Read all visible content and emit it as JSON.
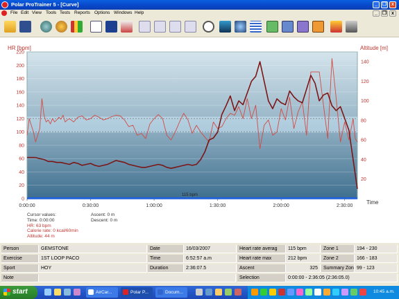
{
  "window": {
    "title": "Polar ProTrainer 5 - [Curve]"
  },
  "window_buttons": {
    "minimize": "_",
    "restore": "❐",
    "close": "x"
  },
  "menu": {
    "items": [
      "File",
      "Edit",
      "View",
      "Tools",
      "Tests",
      "Reports",
      "Options",
      "Windows",
      "Help"
    ]
  },
  "toolbar": {
    "icons": [
      "open-folder-icon",
      "save-disk-icon",
      "add-exercise-icon",
      "settings-wheel-icon",
      "bar-stats-icon",
      "calendar-icon",
      "diary-book-icon",
      "fitness-person-icon",
      "curve-view-icon",
      "bar-view-icon",
      "table-view-icon",
      "laps-view-icon",
      "zoom-icon",
      "upload-icon",
      "sync-icon",
      "data-wave-icon",
      "report-green-icon",
      "report-blue-icon",
      "report-purple-icon",
      "report-orange-icon",
      "report-red-icon",
      "tools-icon"
    ]
  },
  "chart_data": {
    "type": "line",
    "title": "",
    "ylabel": "HR [bpm]",
    "y2label": "Altitude [m]",
    "xlabel": "Time",
    "ylim": [
      0,
      220
    ],
    "y2lim": [
      0,
      150
    ],
    "xlim": [
      "0:00:00",
      "2:36:05"
    ],
    "yticks": [
      "0",
      "20",
      "40",
      "60",
      "80",
      "100",
      "120",
      "140",
      "160",
      "180",
      "200",
      "220"
    ],
    "y2ticks": [
      "20",
      "40",
      "60",
      "80",
      "100",
      "120",
      "140"
    ],
    "xticks": [
      "0:00:00",
      "0:30:00",
      "1:00:00",
      "1:30:00",
      "2:00:00",
      "2:30:00"
    ],
    "grid": true,
    "zone_band": {
      "low": 99,
      "high": 123,
      "color": "#c8e4f4"
    },
    "baseline_label": "115 bpm",
    "series": [
      {
        "name": "HR",
        "color": "#d24a44",
        "x": [
          0,
          1,
          2,
          3,
          4,
          5,
          6,
          7,
          8,
          9,
          10,
          11,
          12,
          13,
          14,
          15,
          16,
          17,
          18,
          19,
          20,
          22,
          24,
          26,
          28,
          30,
          32,
          34,
          36,
          38,
          40,
          42,
          44,
          46,
          48,
          50,
          52,
          54,
          56,
          58,
          60,
          62,
          64,
          66,
          68,
          70,
          72,
          74,
          76,
          78,
          80,
          82,
          84,
          86,
          88,
          90,
          92,
          94,
          96,
          98,
          100,
          102,
          104,
          106,
          108,
          110,
          112,
          114,
          116,
          118,
          120,
          122,
          124,
          126,
          128,
          130,
          132,
          134,
          136,
          138,
          140,
          142,
          144,
          146,
          148,
          150,
          152,
          154,
          155,
          156
        ],
        "y": [
          95,
          120,
          110,
          100,
          85,
          95,
          105,
          150,
          125,
          115,
          118,
          112,
          120,
          115,
          118,
          122,
          119,
          125,
          115,
          118,
          120,
          115,
          122,
          124,
          118,
          120,
          125,
          122,
          118,
          120,
          123,
          125,
          124,
          118,
          108,
          110,
          95,
          98,
          90,
          112,
          120,
          126,
          120,
          95,
          88,
          100,
          115,
          128,
          118,
          98,
          110,
          100,
          92,
          85,
          115,
          105,
          108,
          120,
          128,
          125,
          138,
          120,
          150,
          120,
          140,
          75,
          110,
          118,
          95,
          100,
          135,
          118,
          152,
          105,
          130,
          145,
          95,
          190,
          190,
          190,
          140,
          90,
          210,
          150,
          85,
          115,
          88,
          120,
          90,
          85
        ]
      },
      {
        "name": "Altitude",
        "color": "#7a1616",
        "x": [
          0,
          2,
          4,
          6,
          8,
          10,
          12,
          14,
          16,
          18,
          20,
          22,
          24,
          26,
          28,
          30,
          32,
          34,
          36,
          38,
          40,
          42,
          44,
          46,
          48,
          50,
          52,
          54,
          56,
          58,
          60,
          62,
          64,
          66,
          68,
          70,
          72,
          74,
          76,
          78,
          80,
          82,
          84,
          86,
          88,
          90,
          92,
          94,
          96,
          98,
          100,
          102,
          104,
          106,
          108,
          110,
          112,
          114,
          116,
          118,
          120,
          122,
          124,
          126,
          128,
          130,
          132,
          134,
          136,
          138,
          140,
          142,
          144,
          146,
          148,
          150,
          152,
          154,
          156
        ],
        "y": [
          42,
          42,
          42,
          41,
          40,
          38,
          38,
          37,
          37,
          36,
          35,
          37,
          36,
          34,
          35,
          36,
          34,
          33,
          34,
          35,
          37,
          39,
          38,
          37,
          35,
          34,
          33,
          32,
          32,
          33,
          34,
          35,
          34,
          32,
          31,
          32,
          33,
          34,
          35,
          34,
          35,
          40,
          48,
          60,
          62,
          68,
          86,
          95,
          105,
          90,
          100,
          96,
          108,
          120,
          125,
          140,
          120,
          100,
          92,
          102,
          98,
          96,
          110,
          104,
          100,
          98,
          112,
          126,
          118,
          100,
          106,
          108,
          95,
          90,
          94,
          82,
          70,
          40,
          10
        ]
      }
    ]
  },
  "cursor_values": {
    "header": "Cursor values:",
    "time": "Time: 0:00:00",
    "hr": "HR: 63 bpm",
    "calorie": "Calorie rate: 0 kcal/60min",
    "altitude": "Altitude: 44 m",
    "ascent": "Ascent: 0 m",
    "descent": "Descent: 0 m"
  },
  "info": {
    "person_label": "Person",
    "person": "GEMSTONE",
    "exercise_label": "Exercise",
    "exercise": "1ST LOOP PACO",
    "sport_label": "Sport",
    "sport": "HOY",
    "note_label": "Note",
    "note": "",
    "date_label": "Date",
    "date": "16/03/2007",
    "time_label": "Time",
    "time": "6:52:57 a.m",
    "duration_label": "Duration",
    "duration": "2:36:07.5",
    "hr_avg_label": "Heart rate averag",
    "hr_avg": "115 bpm",
    "hr_max_label": "Heart rate max",
    "hr_max": "212 bpm",
    "ascent_label": "Ascent",
    "ascent": "325",
    "selection_label": "Selection",
    "selection": "0:00:00 - 2:36:05 (2:36:05.0)",
    "zone1_label": "Zone 1",
    "zone1": "194 - 230",
    "zone2_label": "Zone 2",
    "zone2": "166 - 183",
    "summary_label": "Summary Zon",
    "summary": "99 - 123"
  },
  "taskbar": {
    "start": "start",
    "tasks": [
      "AirCar...",
      "Polar P...",
      "Docum..."
    ],
    "clock": "10:45 a.m."
  }
}
